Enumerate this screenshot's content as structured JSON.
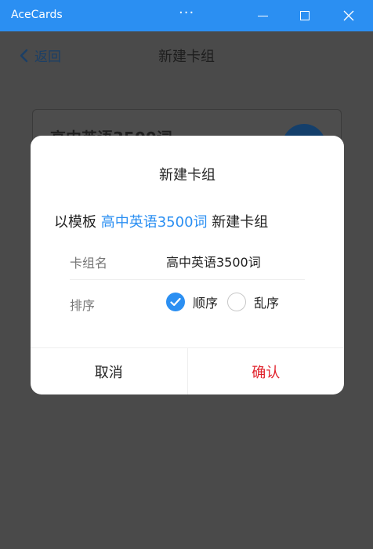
{
  "window": {
    "title": "AceCards",
    "more_label": "···"
  },
  "header": {
    "back_label": "返回",
    "title": "新建卡组"
  },
  "background_card": {
    "title": "高中英语3500词"
  },
  "dialog": {
    "title": "新建卡组",
    "desc_prefix": "以模板",
    "desc_template": "高中英语3500词",
    "desc_suffix": "新建卡组",
    "name_label": "卡组名",
    "name_value": "高中英语3500词",
    "sort_label": "排序",
    "sort_options": [
      {
        "label": "顺序",
        "selected": true
      },
      {
        "label": "乱序",
        "selected": false
      }
    ],
    "cancel_label": "取消",
    "confirm_label": "确认"
  },
  "colors": {
    "accent": "#2b8ff2",
    "confirm": "#e0202a",
    "overlay": "#4a4a4a"
  }
}
